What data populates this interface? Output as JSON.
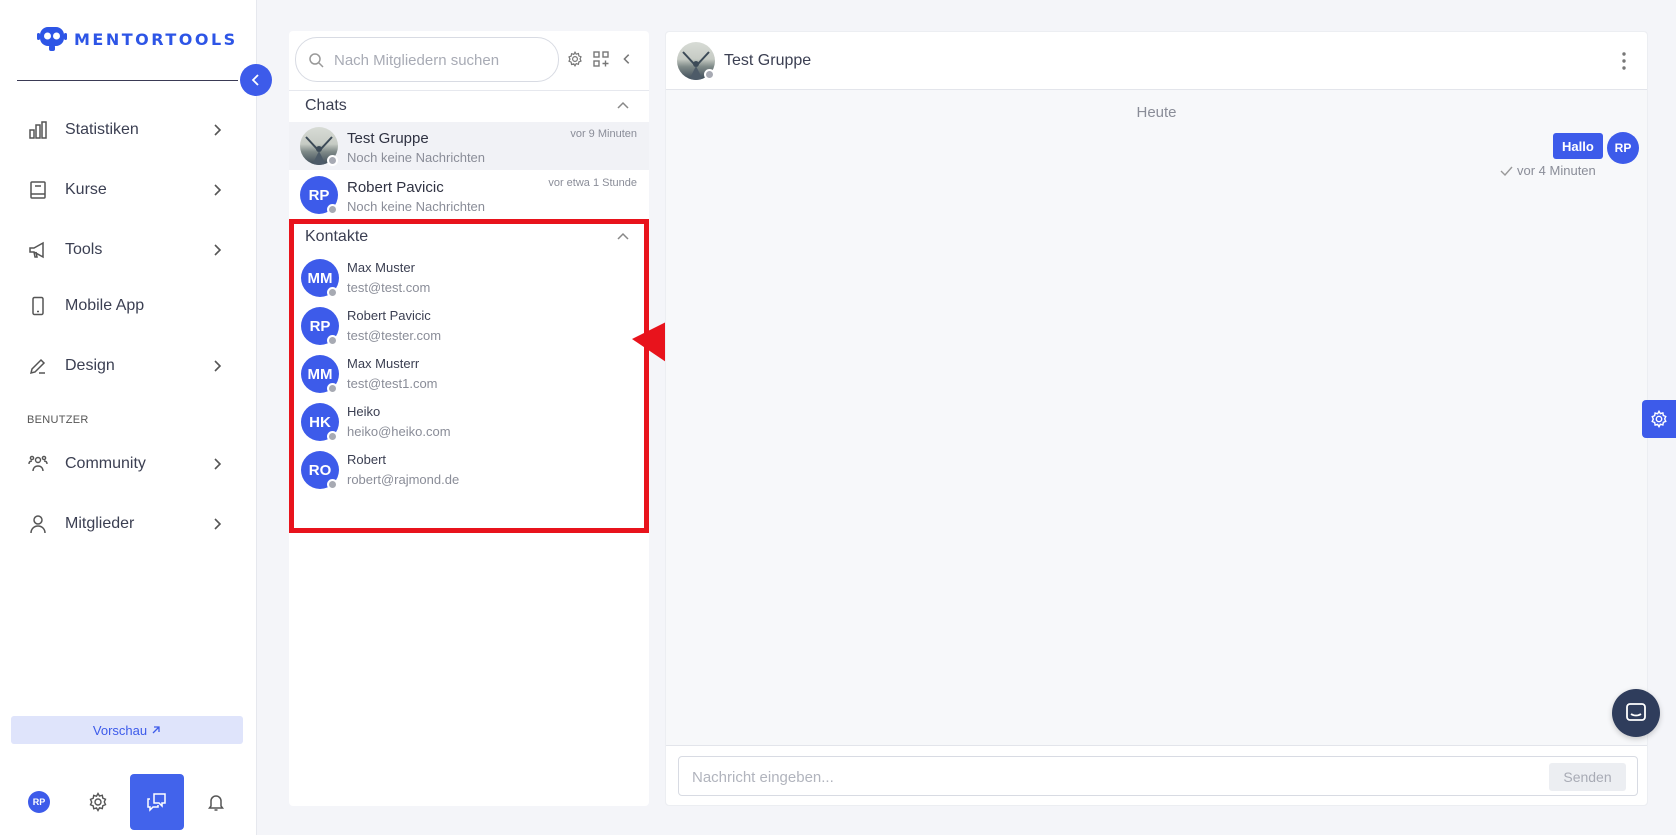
{
  "brand": {
    "name": "MENTORTOOLS",
    "color": "#2d55e6"
  },
  "sidebar": {
    "items": [
      {
        "label": "Statistiken",
        "icon": "bar-chart-icon",
        "has_chevron": true
      },
      {
        "label": "Kurse",
        "icon": "book-icon",
        "has_chevron": true
      },
      {
        "label": "Tools",
        "icon": "megaphone-icon",
        "has_chevron": true
      },
      {
        "label": "Mobile App",
        "icon": "mobile-phone-icon",
        "has_chevron": false
      },
      {
        "label": "Design",
        "icon": "pencil-icon",
        "has_chevron": true
      }
    ],
    "section_label": "BENUTZER",
    "user_items": [
      {
        "label": "Community",
        "icon": "community-icon",
        "has_chevron": true
      },
      {
        "label": "Mitglieder",
        "icon": "user-icon",
        "has_chevron": true
      }
    ],
    "preview_label": "Vorschau",
    "bottom": {
      "avatar_initials": "RP"
    }
  },
  "chat_list": {
    "search_placeholder": "Nach Mitgliedern suchen",
    "chats_heading": "Chats",
    "chats": [
      {
        "name": "Test Gruppe",
        "subtitle": "Noch keine Nachrichten",
        "time": "vor 9 Minuten",
        "avatar": "photo",
        "active": true
      },
      {
        "name": "Robert Pavicic",
        "subtitle": "Noch keine Nachrichten",
        "time": "vor etwa 1 Stunde",
        "initials": "RP",
        "active": false
      }
    ],
    "contacts_heading": "Kontakte",
    "contacts": [
      {
        "name": "Max Muster",
        "email": "test@test.com",
        "initials": "MM"
      },
      {
        "name": "Robert Pavicic",
        "email": "test@tester.com",
        "initials": "RP"
      },
      {
        "name": "Max Musterr",
        "email": "test@test1.com",
        "initials": "MM"
      },
      {
        "name": "Heiko",
        "email": "heiko@heiko.com",
        "initials": "HK"
      },
      {
        "name": "Robert",
        "email": "robert@rajmond.de",
        "initials": "RO"
      }
    ]
  },
  "conversation": {
    "title": "Test Gruppe",
    "day_label": "Heute",
    "messages": [
      {
        "text": "Hallo",
        "sender_initials": "RP",
        "time": "vor 4 Minuten"
      }
    ],
    "input_placeholder": "Nachricht eingeben...",
    "send_label": "Senden"
  },
  "colors": {
    "accent": "#3d5bea",
    "highlight": "#e8131c"
  }
}
